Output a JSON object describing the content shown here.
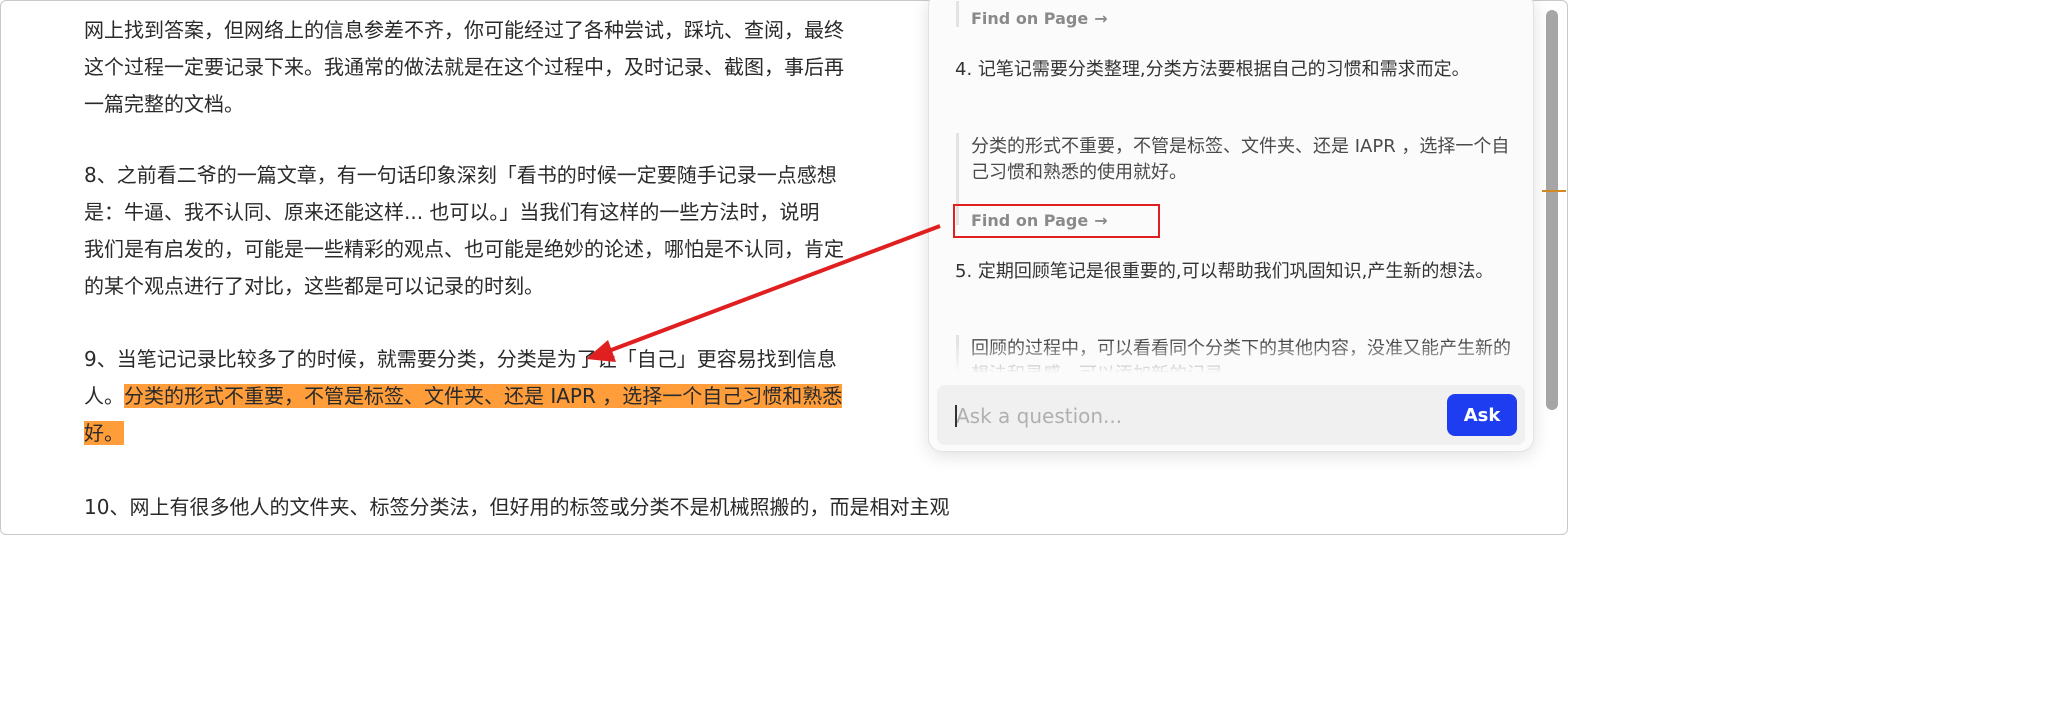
{
  "article": {
    "lines": [
      "网上找到答案，但网络上的信息参差不齐，你可能经过了各种尝试，踩坑、查阅，最终",
      "这个过程一定要记录下来。我通常的做法就是在这个过程中，及时记录、截图，事后再",
      "一篇完整的文档。",
      "8、之前看二爷的一篇文章，有一句话印象深刻「看书的时候一定要随手记录一点感想",
      "是：牛逼、我不认同、原来还能这样... 也可以。」当我们有这样的一些方法时，说明",
      "我们是有启发的，可能是一些精彩的观点、也可能是绝妙的论述，哪怕是不认同，肯定",
      "的某个观点进行了对比，这些都是可以记录的时刻。",
      "9、当笔记记录比较多了的时候，就需要分类，分类是为了让「自己」更容易找到信息",
      "人。",
      "分类的形式不重要，不管是标签、文件夹、还是 IAPR ，选择一个自己习惯和熟悉",
      "好。",
      "10、网上有很多他人的文件夹、标签分类法，但好用的标签或分类不是机械照搬的，而是相对主观"
    ]
  },
  "popup": {
    "find_label": "Find on Page",
    "arrow": "→",
    "item4": "4. 记笔记需要分类整理,分类方法要根据自己的习惯和需求而定。",
    "quote4": "分类的形式不重要，不管是标签、文件夹、还是 IAPR ，选择一个自己习惯和熟悉的使用就好。",
    "item5": "5. 定期回顾笔记是很重要的,可以帮助我们巩固知识,产生新的想法。",
    "quote5": "回顾的过程中，可以看看同个分类下的其他内容，没准又能产生新的想法和灵感，可以添加新的记录。",
    "ask_placeholder": "Ask a question...",
    "ask_button": "Ask"
  },
  "colors": {
    "highlight": "#ff9d3b",
    "annotation": "#e02020",
    "ask_button": "#1f3df0"
  }
}
